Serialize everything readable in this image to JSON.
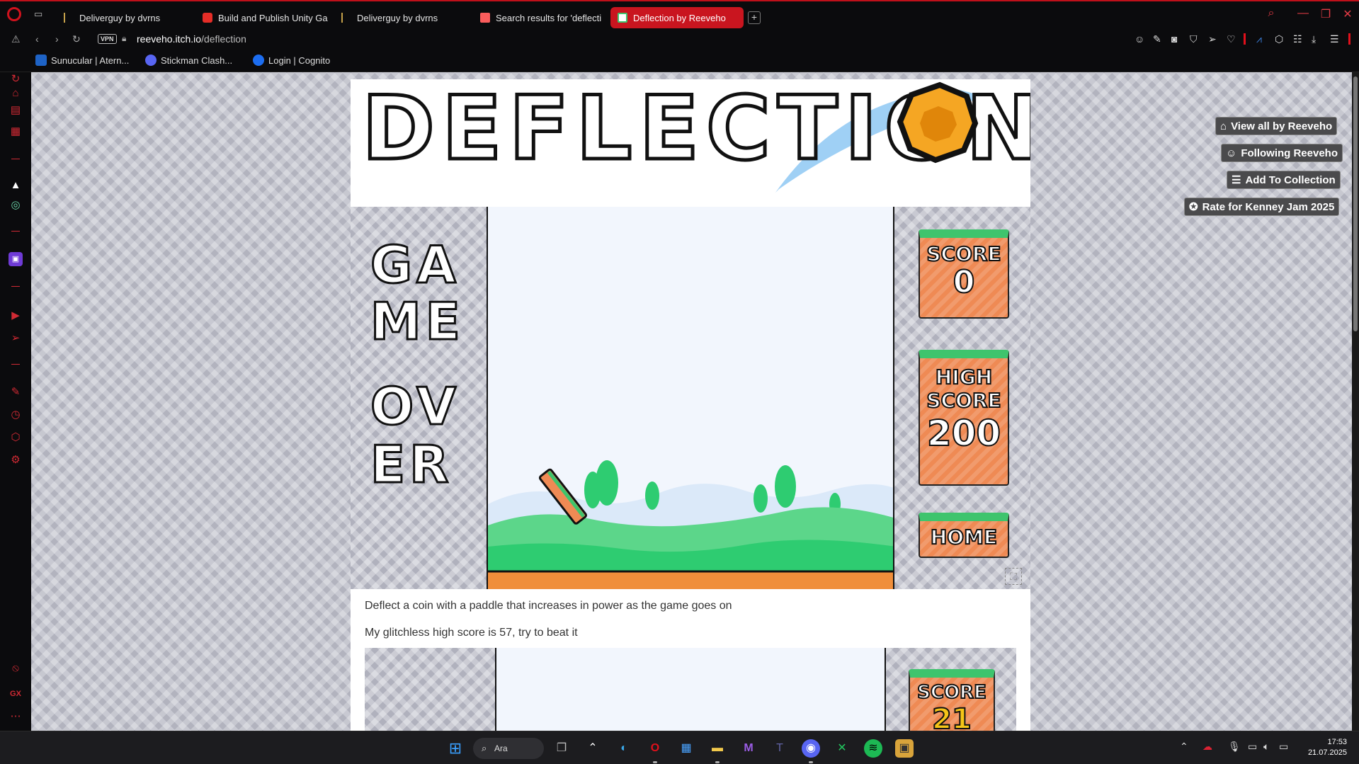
{
  "tabs": [
    {
      "title": "Deliverguy by dvrns",
      "active": false,
      "favicon": "itch-icon"
    },
    {
      "title": "Build and Publish Unity Ga",
      "active": false,
      "favicon": "youtube-icon"
    },
    {
      "title": "Deliverguy by dvrns",
      "active": false,
      "favicon": "itch-icon"
    },
    {
      "title": "Search results for 'deflecti",
      "active": false,
      "favicon": "itch-store-icon"
    },
    {
      "title": "Deflection by Reeveho",
      "active": true,
      "favicon": "deflection-icon"
    }
  ],
  "address": {
    "vpn_label": "VPN",
    "url_host": "reeveho.itch.io",
    "url_path": "/deflection"
  },
  "bookmarks": [
    {
      "label": "Sunucular | Atern...",
      "color": "#1e63c6"
    },
    {
      "label": "Stickman Clash...",
      "color": "#5865f2"
    },
    {
      "label": "Login | Cognito",
      "color": "#1c6df0"
    }
  ],
  "sidebar": {
    "bottom_label": "GX"
  },
  "game": {
    "banner_title": "DEFLECTION",
    "game_over_lines": [
      "GA",
      "ME",
      "OV",
      "ER"
    ],
    "score_label": "SCORE",
    "score_value": "0",
    "high_score_label_1": "HIGH",
    "high_score_label_2": "SCORE",
    "high_score_value": "200",
    "home_label": "HOME"
  },
  "description": [
    "Deflect a coin with a paddle that increases in power as the game goes on",
    "My glitchless high score is 57, try to beat it"
  ],
  "preview": {
    "score_label": "SCORE",
    "score_value": "21"
  },
  "itch_buttons": [
    {
      "label": "View all by Reeveho",
      "icon": "store-icon"
    },
    {
      "label": "Following Reeveho",
      "icon": "user-check-icon"
    },
    {
      "label": "Add To Collection",
      "icon": "add-list-icon"
    },
    {
      "label": "Rate for Kenney Jam 2025",
      "icon": "award-icon"
    }
  ],
  "taskbar": {
    "search_label": "Ara",
    "time": "17:53",
    "date": "21.07.2025"
  },
  "colors": {
    "accent": "#c9151f",
    "tile_orange": "#ef8a54",
    "grass": "#2ecc71",
    "sky": "#f2f6fd"
  }
}
